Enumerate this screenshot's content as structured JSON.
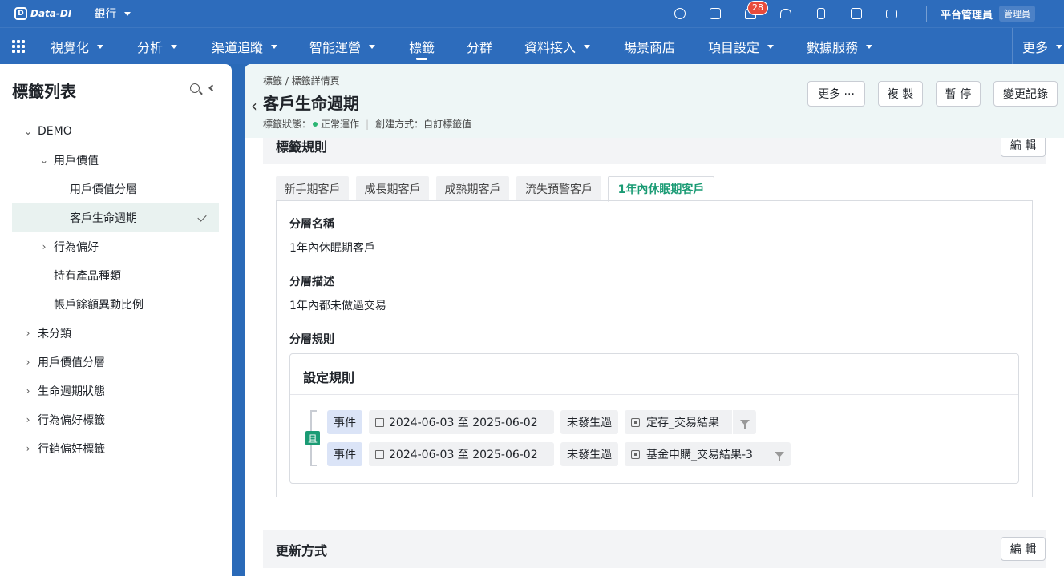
{
  "topbar": {
    "logo_text": "Data-DI",
    "logo_mark": "D",
    "org": "銀行",
    "notifications_count": "28",
    "admin_name": "平台管理員",
    "admin_role": "管理員"
  },
  "nav": {
    "items": [
      {
        "label": "視覺化"
      },
      {
        "label": "分析"
      },
      {
        "label": "渠道追蹤"
      },
      {
        "label": "智能運營"
      },
      {
        "label": "標籤"
      },
      {
        "label": "分群"
      },
      {
        "label": "資料接入"
      },
      {
        "label": "場景商店"
      },
      {
        "label": "項目設定"
      },
      {
        "label": "數據服務"
      },
      {
        "label": "更多"
      }
    ]
  },
  "left": {
    "title": "標籤列表",
    "tree": [
      {
        "label": "DEMO"
      },
      {
        "label": "用戶價值"
      },
      {
        "label": "用戶價值分層"
      },
      {
        "label": "客戶生命週期"
      },
      {
        "label": "行為偏好"
      },
      {
        "label": "持有產品種類"
      },
      {
        "label": "帳戶餘額異動比例"
      },
      {
        "label": "未分類"
      },
      {
        "label": "用戶價值分層"
      },
      {
        "label": "生命週期狀態"
      },
      {
        "label": "行為偏好標籤"
      },
      {
        "label": "行銷偏好標籤"
      }
    ]
  },
  "header": {
    "breadcrumb": "標籤 / 標籤詳情頁",
    "title": "客戶生命週期",
    "status_label": "標籤狀態：",
    "status_value": "正常運作",
    "create_label": "創建方式：自訂標籤值",
    "buttons": {
      "more": "更多 ···",
      "copy": "複 製",
      "pause": "暫 停",
      "history": "變更記錄"
    }
  },
  "rules_section": {
    "title": "標籤規則",
    "edit": "編 輯",
    "tabs": [
      {
        "label": "新手期客戶"
      },
      {
        "label": "成長期客戶"
      },
      {
        "label": "成熟期客戶"
      },
      {
        "label": "流失預警客戶"
      },
      {
        "label": "1年內休眠期客戶"
      }
    ],
    "layer_name_label": "分層名稱",
    "layer_name_value": "1年內休眠期客戶",
    "layer_desc_label": "分層描述",
    "layer_desc_value": "1年內都未做過交易",
    "layer_rule_label": "分層規則",
    "rule_box_title": "設定規則",
    "and_label": "且",
    "conditions": [
      {
        "type": "事件",
        "date_range": "2024-06-03 至 2025-06-02",
        "op": "未發生過",
        "event": "定存_交易結果"
      },
      {
        "type": "事件",
        "date_range": "2024-06-03 至 2025-06-02",
        "op": "未發生過",
        "event": "基金申購_交易結果-3"
      }
    ]
  },
  "update_section": {
    "title": "更新方式",
    "edit": "編 輯"
  }
}
